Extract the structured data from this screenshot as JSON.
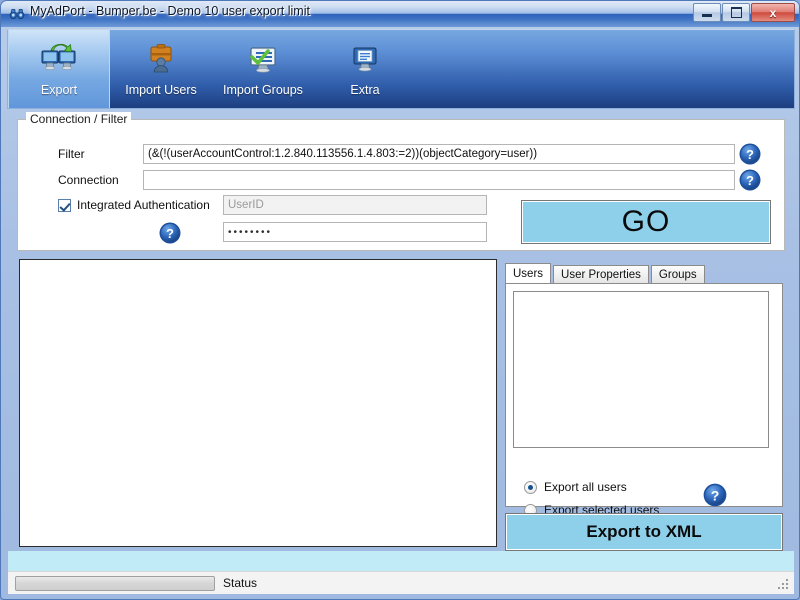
{
  "window": {
    "title": "MyAdPort - Bumper.be - Demo 10 user export limit",
    "app_icon": "binoculars-icon",
    "controls": {
      "minimize": "Minimize",
      "maximize": "Maximize",
      "close": "Close",
      "close_glyph": "x"
    }
  },
  "ribbon": {
    "tabs": [
      {
        "label": "Export",
        "icon": "export-monitors-icon",
        "active": true
      },
      {
        "label": "Import Users",
        "icon": "import-users-briefcase-icon",
        "active": false
      },
      {
        "label": "Import Groups",
        "icon": "import-groups-monitor-icon",
        "active": false
      },
      {
        "label": "Extra",
        "icon": "extra-document-monitor-icon",
        "active": false
      }
    ]
  },
  "connection_group": {
    "caption": "Connection / Filter",
    "filter": {
      "label": "Filter",
      "value": "(&(!(userAccountControl:1.2.840.113556.1.4.803:=2))(objectCategory=user))",
      "placeholder": ""
    },
    "connection": {
      "label": "Connection",
      "value": "",
      "placeholder": ""
    },
    "integrated_auth": {
      "label": "Integrated Authentication",
      "checked": true
    },
    "userid": {
      "value": "",
      "placeholder": "UserID"
    },
    "password": {
      "value": "••••••••",
      "placeholder": ""
    },
    "help_filter": "help-icon",
    "help_connection": "help-icon",
    "help_auth": "help-icon"
  },
  "go_button": {
    "label": "GO",
    "color": "#8ed0ea"
  },
  "results_list": {
    "items": []
  },
  "right_panel": {
    "tabs": [
      {
        "label": "Users",
        "active": true
      },
      {
        "label": "User Properties",
        "active": false
      },
      {
        "label": "Groups",
        "active": false
      }
    ],
    "list_items": [],
    "export_options": [
      {
        "label": "Export all users",
        "selected": true
      },
      {
        "label": "Export selected users",
        "selected": false
      }
    ],
    "help_export": "help-icon"
  },
  "export_xml_button": {
    "label": "Export to XML",
    "color": "#8ed0ea"
  },
  "statusbar": {
    "progress_percent": 0,
    "text": "Status"
  }
}
